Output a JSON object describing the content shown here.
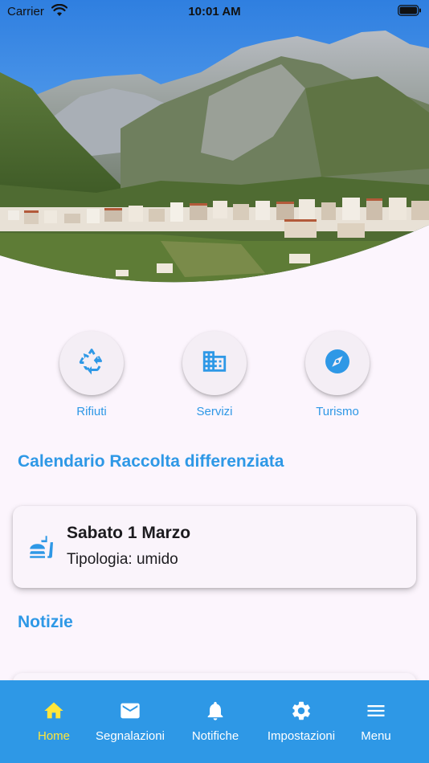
{
  "status_bar": {
    "carrier": "Carrier",
    "time": "10:01 AM"
  },
  "shortcuts": [
    {
      "label": "Rifiuti",
      "icon": "recycle-icon"
    },
    {
      "label": "Servizi",
      "icon": "building-icon"
    },
    {
      "label": "Turismo",
      "icon": "compass-icon"
    }
  ],
  "calendar": {
    "title": "Calendario Raccolta differenziata",
    "entry": {
      "date": "Sabato 1 Marzo",
      "type": "Tipologia: umido",
      "icon": "food-waste-icon"
    }
  },
  "news": {
    "title": "Notizie"
  },
  "bottom_nav": {
    "items": [
      {
        "label": "Home",
        "icon": "home-icon",
        "active": true
      },
      {
        "label": "Segnalazioni",
        "icon": "mail-icon",
        "active": false
      },
      {
        "label": "Notifiche",
        "icon": "bell-icon",
        "active": false
      },
      {
        "label": "Impostazioni",
        "icon": "gear-icon",
        "active": false
      },
      {
        "label": "Menu",
        "icon": "menu-icon",
        "active": false
      }
    ]
  },
  "colors": {
    "accent": "#2e98e6",
    "active_nav": "#ffe63b",
    "background": "#fcf5fd"
  }
}
